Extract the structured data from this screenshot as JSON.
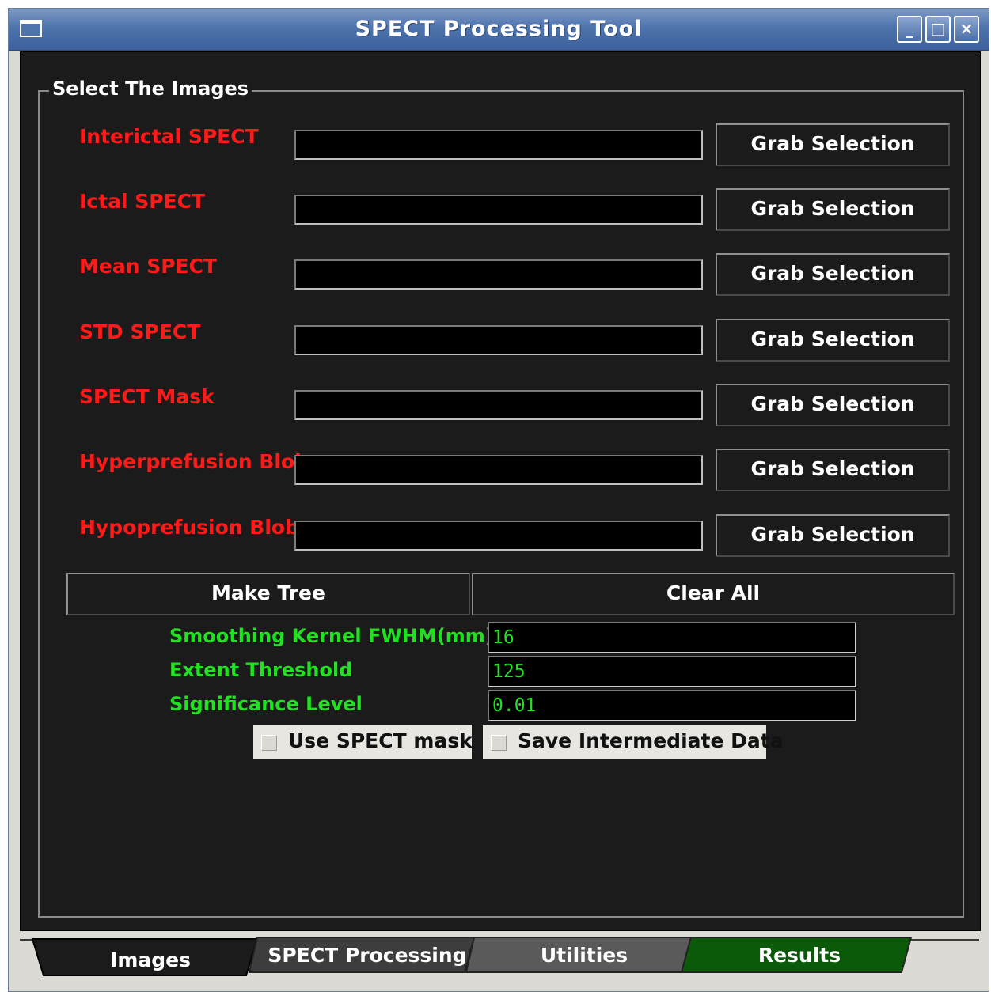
{
  "window": {
    "title": "SPECT Processing Tool",
    "min": "_",
    "max": "□",
    "close": "×"
  },
  "group_title": "Select The Images",
  "rows": [
    {
      "label": "Interictal SPECT",
      "value": "",
      "button": "Grab Selection"
    },
    {
      "label": "Ictal SPECT",
      "value": "",
      "button": "Grab Selection"
    },
    {
      "label": "Mean SPECT",
      "value": "",
      "button": "Grab Selection"
    },
    {
      "label": "STD SPECT",
      "value": "",
      "button": "Grab Selection"
    },
    {
      "label": "SPECT Mask",
      "value": "",
      "button": "Grab Selection"
    },
    {
      "label": "Hyperprefusion Blob",
      "value": "",
      "button": "Grab Selection"
    },
    {
      "label": "Hypoprefusion Blob",
      "value": "",
      "button": "Grab Selection"
    }
  ],
  "actions": {
    "make_tree": "Make Tree",
    "clear_all": "Clear All"
  },
  "params": [
    {
      "label": "Smoothing Kernel FWHM(mm)",
      "value": "16"
    },
    {
      "label": "Extent Threshold",
      "value": "125"
    },
    {
      "label": "Significance Level",
      "value": "0.01"
    }
  ],
  "checkboxes": [
    {
      "label": "Use SPECT mask",
      "checked": false
    },
    {
      "label": "Save Intermediate Data",
      "checked": false
    }
  ],
  "tabs": [
    {
      "label": "Images",
      "active": true,
      "color": "#1b1b1b"
    },
    {
      "label": "SPECT Processing",
      "active": false,
      "color": "#3d3d3d"
    },
    {
      "label": "Utilities",
      "active": false,
      "color": "#5a5a5a"
    },
    {
      "label": "Results",
      "active": false,
      "color": "#0a5a0a"
    }
  ]
}
